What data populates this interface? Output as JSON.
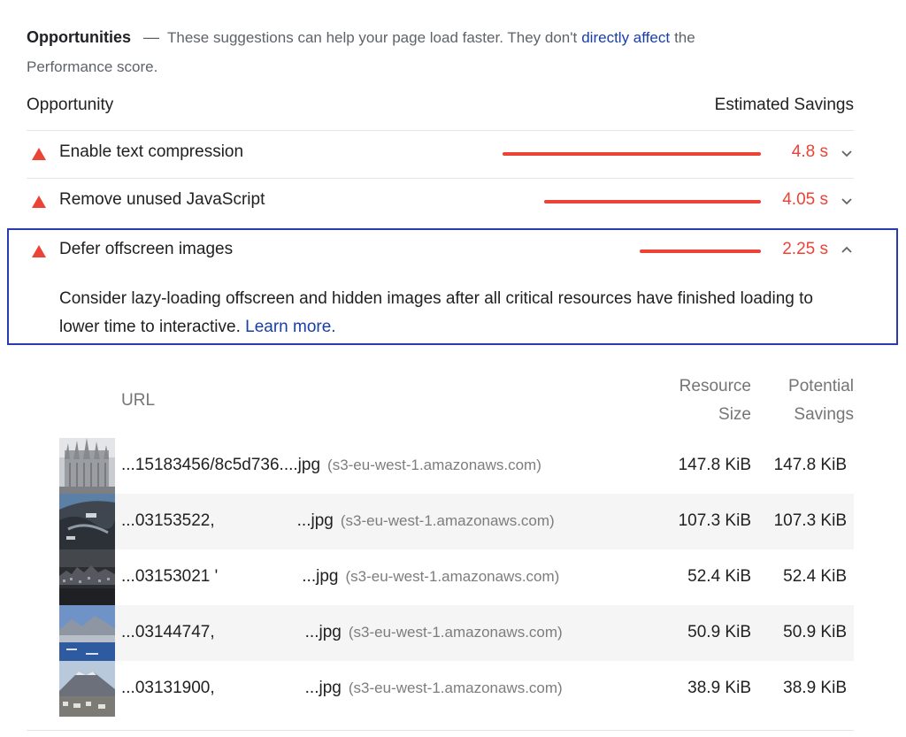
{
  "header": {
    "title": "Opportunities",
    "dash": "—",
    "description": "These suggestions can help your page load faster. They don't",
    "link": "directly affect",
    "suffix": "the",
    "line2": "Performance score."
  },
  "columns": {
    "opportunity": "Opportunity",
    "savings": "Estimated Savings"
  },
  "accent_color": "#eb4335",
  "opportunities": [
    {
      "label": "Enable text compression",
      "savings": "4.8 s",
      "bar_fraction": 1.0,
      "expanded": false,
      "icon": "chevron-down-icon"
    },
    {
      "label": "Remove unused JavaScript",
      "savings": "4.05 s",
      "bar_fraction": 0.84,
      "expanded": false,
      "icon": "chevron-down-icon"
    },
    {
      "label": "Defer offscreen images",
      "savings": "2.25 s",
      "bar_fraction": 0.47,
      "expanded": true,
      "icon": "chevron-up-icon"
    }
  ],
  "details": {
    "text": "Consider lazy-loading offscreen and hidden images after all critical resources have finished loading to lower time to interactive.",
    "learn_more": "Learn more."
  },
  "table": {
    "headers": {
      "url": "URL",
      "resource_size_1": "Resource",
      "resource_size_2": "Size",
      "potential_savings_1": "Potential",
      "potential_savings_2": "Savings"
    },
    "rows": [
      {
        "url_start": "...15183456/8c5d736....jpg",
        "url_end": "",
        "host": "(s3-eu-west-1.amazonaws.com)",
        "size": "147.8 KiB",
        "savings": "147.8 KiB",
        "thumb": "cathedral-thumbnail"
      },
      {
        "url_start": "...03153522,",
        "url_end": "...jpg",
        "host": "(s3-eu-west-1.amazonaws.com)",
        "size": "107.3 KiB",
        "savings": "107.3 KiB",
        "thumb": "harbor-thumbnail"
      },
      {
        "url_start": "...03153021 '",
        "url_end": "...jpg",
        "host": "(s3-eu-west-1.amazonaws.com)",
        "size": "52.4 KiB",
        "savings": "52.4 KiB",
        "thumb": "city-night-thumbnail"
      },
      {
        "url_start": "...03144747,",
        "url_end": "...jpg",
        "host": "(s3-eu-west-1.amazonaws.com)",
        "size": "50.9 KiB",
        "savings": "50.9 KiB",
        "thumb": "sea-mountain-thumbnail"
      },
      {
        "url_start": "...03131900,",
        "url_end": "...jpg",
        "host": "(s3-eu-west-1.amazonaws.com)",
        "size": "38.9 KiB",
        "savings": "38.9 KiB",
        "thumb": "volcano-thumbnail"
      }
    ]
  }
}
